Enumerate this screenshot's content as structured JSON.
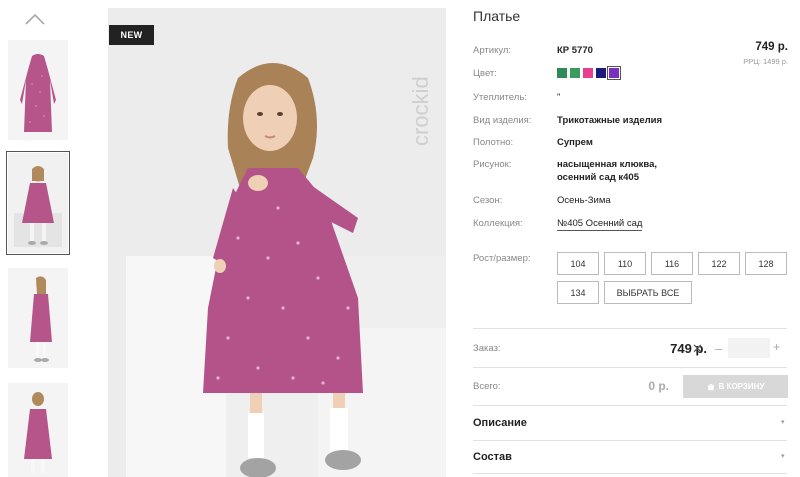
{
  "badge": "NEW",
  "brand": "crockid",
  "product": {
    "title": "Платье",
    "article_label": "Артикул:",
    "article_value": "КР 5770",
    "price": "749 р.",
    "rrp": "РРЦ: 1499 р.",
    "color_label": "Цвет:",
    "colors": [
      "#2e8b57",
      "#3a9d5d",
      "#e83e8c",
      "#1a1a7a",
      "#7b2fbe"
    ],
    "insulation_label": "Утеплитель:",
    "insulation_value": "\"",
    "type_label": "Вид изделия:",
    "type_value": "Трикотажные изделия",
    "fabric_label": "Полотно:",
    "fabric_value": "Супрем",
    "pattern_label": "Рисунок:",
    "pattern_value_1": "насыщенная клюква,",
    "pattern_value_2": "осенний сад к405",
    "season_label": "Сезон:",
    "season_value": "Осень-Зима",
    "collection_label": "Коллекция:",
    "collection_value": "№405 Осенний сад",
    "size_label": "Рост/размер:",
    "sizes": [
      "104",
      "110",
      "116",
      "122",
      "128",
      "134"
    ],
    "select_all": "ВЫБРАТЬ ВСЕ"
  },
  "order": {
    "label": "Заказ:",
    "price": "749 р.",
    "times": "✕",
    "minus": "–",
    "plus": "+",
    "total_label": "Всего:",
    "total_value": "0 р.",
    "cart_button": "В КОРЗИНУ"
  },
  "accordion": {
    "description": "Описание",
    "composition": "Состав",
    "arrow": "▾"
  },
  "icons": {
    "thumb_up": "chevron-up-icon",
    "cart": "basket-icon"
  }
}
